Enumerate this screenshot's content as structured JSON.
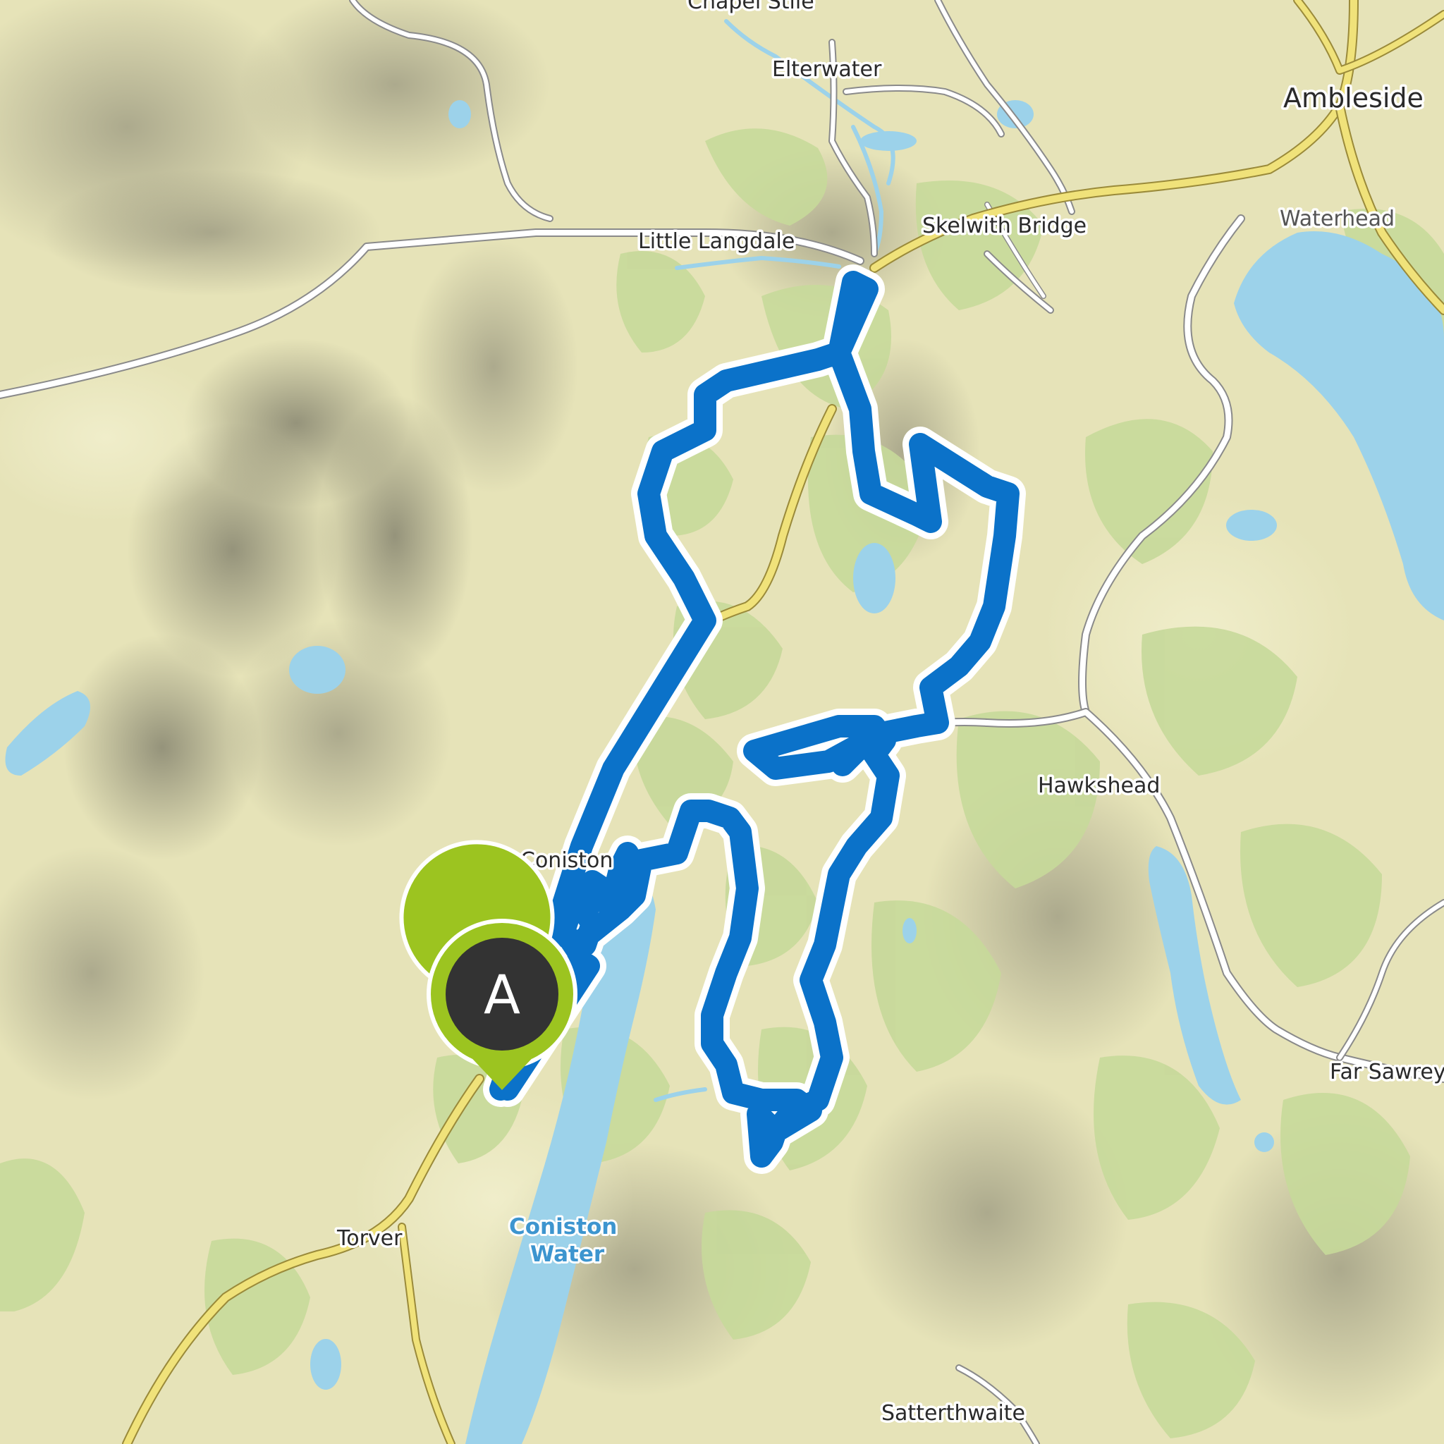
{
  "map": {
    "type": "topographic-route-map",
    "places": {
      "chapel_stile": "Chapel Stile",
      "elterwater": "Elterwater",
      "ambleside": "Ambleside",
      "waterhead": "Waterhead",
      "little_langdale": "Little Langdale",
      "skelwith_bridge": "Skelwith Bridge",
      "hawkshead": "Hawkshead",
      "coniston": "Coniston",
      "far_sawrey": "Far Sawrey",
      "torver": "Torver",
      "satterthwaite": "Satterthwaite"
    },
    "water": {
      "coniston_water_line1": "Coniston",
      "coniston_water_line2": "Water"
    },
    "route": {
      "color": "#0b72c9",
      "outline_color": "#ffffff"
    },
    "start_marker": {
      "letter": "A",
      "pin_color": "#9cc420",
      "badge_color": "#333333"
    },
    "colors": {
      "land": "#e6e3b8",
      "woodland": "#c6d99a",
      "water": "#9cd2ea",
      "major_road": "#f0e27a",
      "minor_road": "#ffffff"
    }
  }
}
